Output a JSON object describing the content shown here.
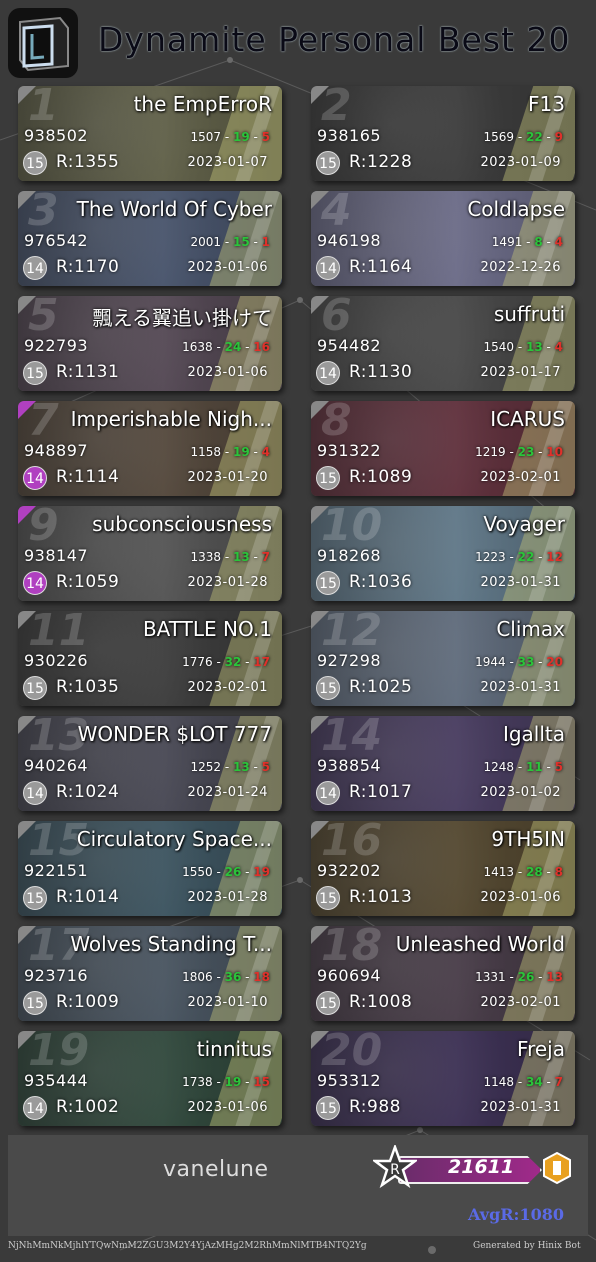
{
  "title": "Dynamite Personal Best 20",
  "cards": [
    {
      "rank": "1",
      "song": "the EmpErroR",
      "score": "938502",
      "c1": "1507",
      "c2": "19",
      "c3": "5",
      "lvl": "15",
      "rating": "R:1355",
      "date": "2023-01-07"
    },
    {
      "rank": "2",
      "song": "F13",
      "score": "938165",
      "c1": "1569",
      "c2": "22",
      "c3": "9",
      "lvl": "15",
      "rating": "R:1228",
      "date": "2023-01-09"
    },
    {
      "rank": "3",
      "song": "The World Of Cyber",
      "score": "976542",
      "c1": "2001",
      "c2": "15",
      "c3": "1",
      "lvl": "14",
      "rating": "R:1170",
      "date": "2023-01-06"
    },
    {
      "rank": "4",
      "song": "Coldlapse",
      "score": "946198",
      "c1": "1491",
      "c2": "8",
      "c3": "4",
      "lvl": "14",
      "rating": "R:1164",
      "date": "2022-12-26"
    },
    {
      "rank": "5",
      "song": "飄える翼追い掛けて",
      "score": "922793",
      "c1": "1638",
      "c2": "24",
      "c3": "16",
      "lvl": "15",
      "rating": "R:1131",
      "date": "2023-01-06"
    },
    {
      "rank": "6",
      "song": "suffruti",
      "score": "954482",
      "c1": "1540",
      "c2": "13",
      "c3": "4",
      "lvl": "14",
      "rating": "R:1130",
      "date": "2023-01-17"
    },
    {
      "rank": "7",
      "song": "Imperishable Nigh...",
      "score": "948897",
      "c1": "1158",
      "c2": "19",
      "c3": "4",
      "lvl": "14",
      "rating": "R:1114",
      "date": "2023-01-20"
    },
    {
      "rank": "8",
      "song": "ICARUS",
      "score": "931322",
      "c1": "1219",
      "c2": "23",
      "c3": "10",
      "lvl": "15",
      "rating": "R:1089",
      "date": "2023-02-01"
    },
    {
      "rank": "9",
      "song": "subconsciousness",
      "score": "938147",
      "c1": "1338",
      "c2": "13",
      "c3": "7",
      "lvl": "14",
      "rating": "R:1059",
      "date": "2023-01-28"
    },
    {
      "rank": "10",
      "song": "Voyager",
      "score": "918268",
      "c1": "1223",
      "c2": "22",
      "c3": "12",
      "lvl": "15",
      "rating": "R:1036",
      "date": "2023-01-31"
    },
    {
      "rank": "11",
      "song": "BATTLE NO.1",
      "score": "930226",
      "c1": "1776",
      "c2": "32",
      "c3": "17",
      "lvl": "15",
      "rating": "R:1035",
      "date": "2023-02-01"
    },
    {
      "rank": "12",
      "song": "Climax",
      "score": "927298",
      "c1": "1944",
      "c2": "33",
      "c3": "20",
      "lvl": "15",
      "rating": "R:1025",
      "date": "2023-01-31"
    },
    {
      "rank": "13",
      "song": "WONDER $LOT 777",
      "score": "940264",
      "c1": "1252",
      "c2": "13",
      "c3": "5",
      "lvl": "14",
      "rating": "R:1024",
      "date": "2023-01-24"
    },
    {
      "rank": "14",
      "song": "Igallta",
      "score": "938854",
      "c1": "1248",
      "c2": "11",
      "c3": "5",
      "lvl": "14",
      "rating": "R:1017",
      "date": "2023-01-02"
    },
    {
      "rank": "15",
      "song": "Circulatory Space...",
      "score": "922151",
      "c1": "1550",
      "c2": "26",
      "c3": "19",
      "lvl": "15",
      "rating": "R:1014",
      "date": "2023-01-28"
    },
    {
      "rank": "16",
      "song": "9TH5IN",
      "score": "932202",
      "c1": "1413",
      "c2": "28",
      "c3": "8",
      "lvl": "15",
      "rating": "R:1013",
      "date": "2023-01-06"
    },
    {
      "rank": "17",
      "song": "Wolves Standing T...",
      "score": "923716",
      "c1": "1806",
      "c2": "36",
      "c3": "18",
      "lvl": "15",
      "rating": "R:1009",
      "date": "2023-01-10"
    },
    {
      "rank": "18",
      "song": "Unleashed World",
      "score": "960694",
      "c1": "1331",
      "c2": "26",
      "c3": "13",
      "lvl": "15",
      "rating": "R:1008",
      "date": "2023-02-01"
    },
    {
      "rank": "19",
      "song": "tinnitus",
      "score": "935444",
      "c1": "1738",
      "c2": "19",
      "c3": "15",
      "lvl": "14",
      "rating": "R:1002",
      "date": "2023-01-06"
    },
    {
      "rank": "20",
      "song": "Freja",
      "score": "953312",
      "c1": "1148",
      "c2": "34",
      "c3": "7",
      "lvl": "15",
      "rating": "R:988",
      "date": "2023-01-31"
    }
  ],
  "player": {
    "name": "vanelune",
    "rating_total": "21611",
    "avg": "AvgR:1080"
  },
  "footer": {
    "hash": "NjNhMmNkMjhlYTQwNmM2ZGU3M2Y4YjAzMHg2M2RhMmNlMTB4NTQ2Yg",
    "generated": "Generated by Hinix Bot"
  },
  "colors": {
    "lvl_purple": "#b040c0",
    "lvl_gray": "#9a9a9a",
    "great": "#2ac43a",
    "miss": "#e0302a"
  }
}
